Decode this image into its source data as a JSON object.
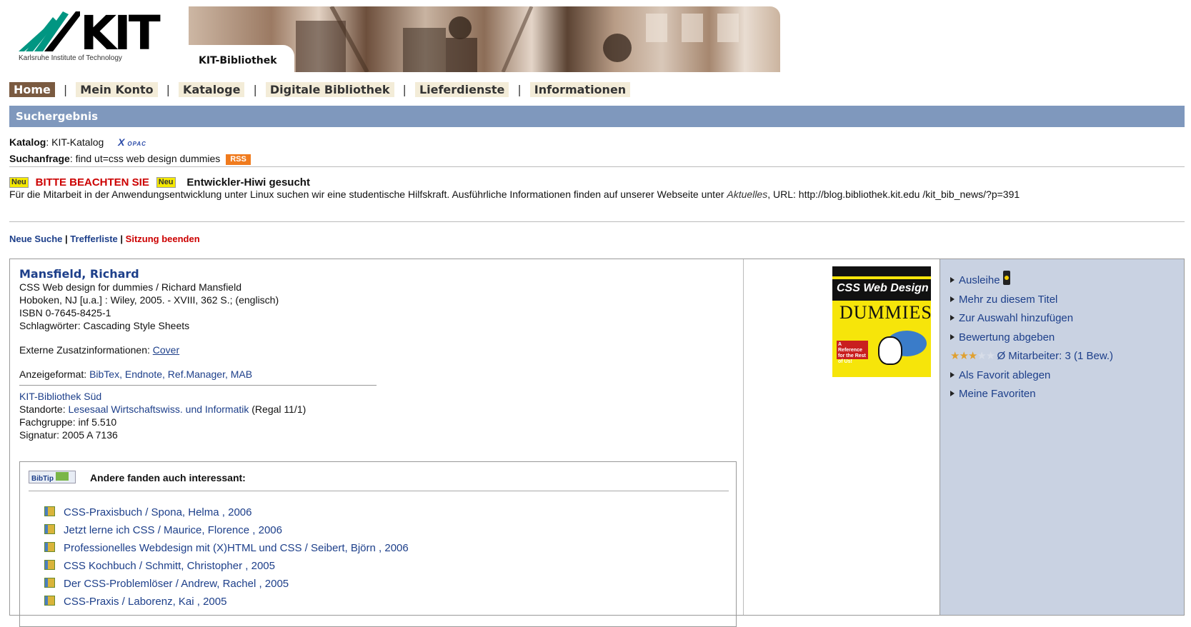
{
  "logo": {
    "wordmark": "KIT",
    "subtitle": "Karlsruhe Institute of Technology"
  },
  "banner": {
    "title": "KIT-Bibliothek"
  },
  "nav": {
    "items": [
      {
        "label": "Home",
        "active": true
      },
      {
        "label": "Mein Konto"
      },
      {
        "label": "Kataloge"
      },
      {
        "label": "Digitale Bibliothek"
      },
      {
        "label": "Lieferdienste"
      },
      {
        "label": "Informationen"
      }
    ],
    "separator": "|"
  },
  "section": {
    "title": "Suchergebnis"
  },
  "query": {
    "katalog_label": "Katalog",
    "katalog_value": ": KIT-Katalog",
    "opac_label": "OPAC",
    "anfrage_label": "Suchanfrage",
    "anfrage_value": ": find ut=css web design dummies",
    "rss_label": "RSS"
  },
  "notice": {
    "neu_badge": "Neu",
    "bitte": "BITTE BEACHTEN SIE",
    "heading": "Entwickler-Hiwi gesucht",
    "text_before": "Für die Mitarbeit in der Anwendungsentwicklung unter Linux suchen wir eine studentische Hilfskraft. Ausführliche Informationen finden auf unserer Webseite unter ",
    "link": "Aktuelles",
    "text_after": ", URL: http://blog.bibliothek.kit.edu /kit_bib_news/?p=391"
  },
  "links": {
    "neue_suche": "Neue Suche",
    "trefferliste": "Trefferliste",
    "sitzung": "Sitzung beenden",
    "sep": " | "
  },
  "record": {
    "author": "Mansfield, Richard",
    "title": "CSS Web design for dummies / Richard Mansfield",
    "publication": "Hoboken, NJ [u.a.] : Wiley, 2005. - XVIII, 362 S.; (englisch)",
    "isbn": "ISBN 0-7645-8425-1",
    "subjects": "Schlagwörter: Cascading Style Sheets",
    "extern_label": "Externe Zusatzinformationen: ",
    "extern_link": "Cover",
    "format_label": "Anzeigeformat: ",
    "format_links": "BibTex, Endnote, Ref.Manager, MAB",
    "library": "KIT-Bibliothek Süd",
    "location_label": "Standorte: ",
    "location_link": "Lesesaal Wirtschaftswiss. und Informatik",
    "location_rest": " (Regal 11/1)",
    "fachgruppe": "Fachgruppe: inf 5.510",
    "signatur": "Signatur: 2005 A 7136"
  },
  "bibtip": {
    "logo": "BibTip",
    "title": "Andere fanden auch interessant:",
    "items": [
      "CSS-Praxisbuch / Spona, Helma , 2006",
      "Jetzt lerne ich CSS / Maurice, Florence , 2006",
      "Professionelles Webdesign mit (X)HTML und CSS / Seibert, Björn , 2006",
      "CSS Kochbuch / Schmitt, Christopher , 2005",
      "Der CSS-Problemlöser / Andrew, Rachel , 2005",
      "CSS-Praxis / Laborenz, Kai , 2005"
    ]
  },
  "cover": {
    "line1": "CSS Web Design",
    "line2": "DUMMIES",
    "badge": "A Reference for the Rest of Us!"
  },
  "side": {
    "ausleihe": "Ausleihe",
    "mehr": "Mehr zu diesem Titel",
    "auswahl": "Zur Auswahl hinzufügen",
    "bewertung": "Bewertung abgeben",
    "rating_value": 3,
    "rating_max": 5,
    "rating_text": "Ø Mitarbeiter: 3 (1 Bew.)",
    "favorit": "Als Favorit ablegen",
    "meine": "Meine Favoriten"
  },
  "colors": {
    "nav_active": "#7a5a40",
    "section_bar": "#7f98bd",
    "sidebar": "#c9d2e2",
    "link": "#1d3f8a",
    "alert": "#cc0000"
  }
}
